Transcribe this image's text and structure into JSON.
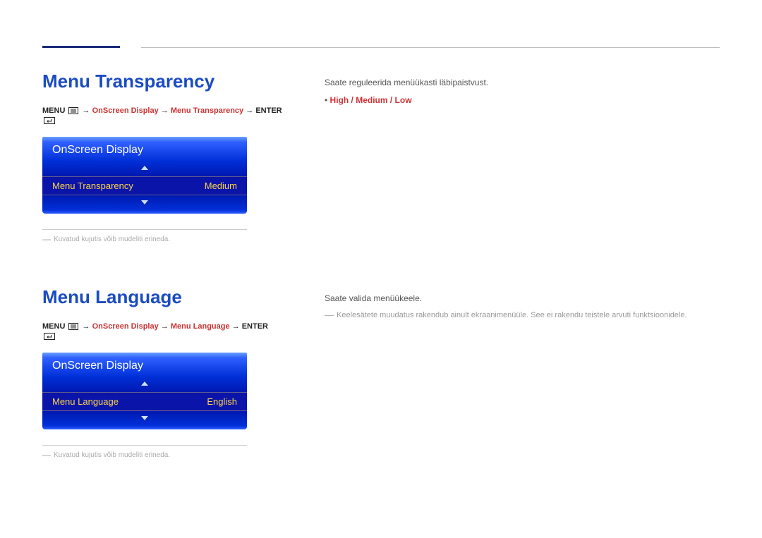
{
  "section1": {
    "title": "Menu Transparency",
    "breadcrumb": {
      "menu": "MENU",
      "path": "OnScreen Display",
      "path2": "Menu Transparency",
      "enter": "ENTER"
    },
    "osd": {
      "header": "OnScreen Display",
      "item_label": "Menu Transparency",
      "item_value": "Medium"
    },
    "note": "Kuvatud kujutis võib mudeliti erineda.",
    "desc": "Saate reguleerida menüükasti läbipaistvust.",
    "options": "High / Medium / Low"
  },
  "section2": {
    "title": "Menu Language",
    "breadcrumb": {
      "menu": "MENU",
      "path": "OnScreen Display",
      "path2": "Menu Language",
      "enter": "ENTER"
    },
    "osd": {
      "header": "OnScreen Display",
      "item_label": "Menu Language",
      "item_value": "English"
    },
    "note": "Kuvatud kujutis võib mudeliti erineda.",
    "desc": "Saate valida menüükeele.",
    "remark": "Keelesätete muudatus rakendub ainult ekraanimenüüle. See ei rakendu teistele arvuti funktsioonidele."
  }
}
